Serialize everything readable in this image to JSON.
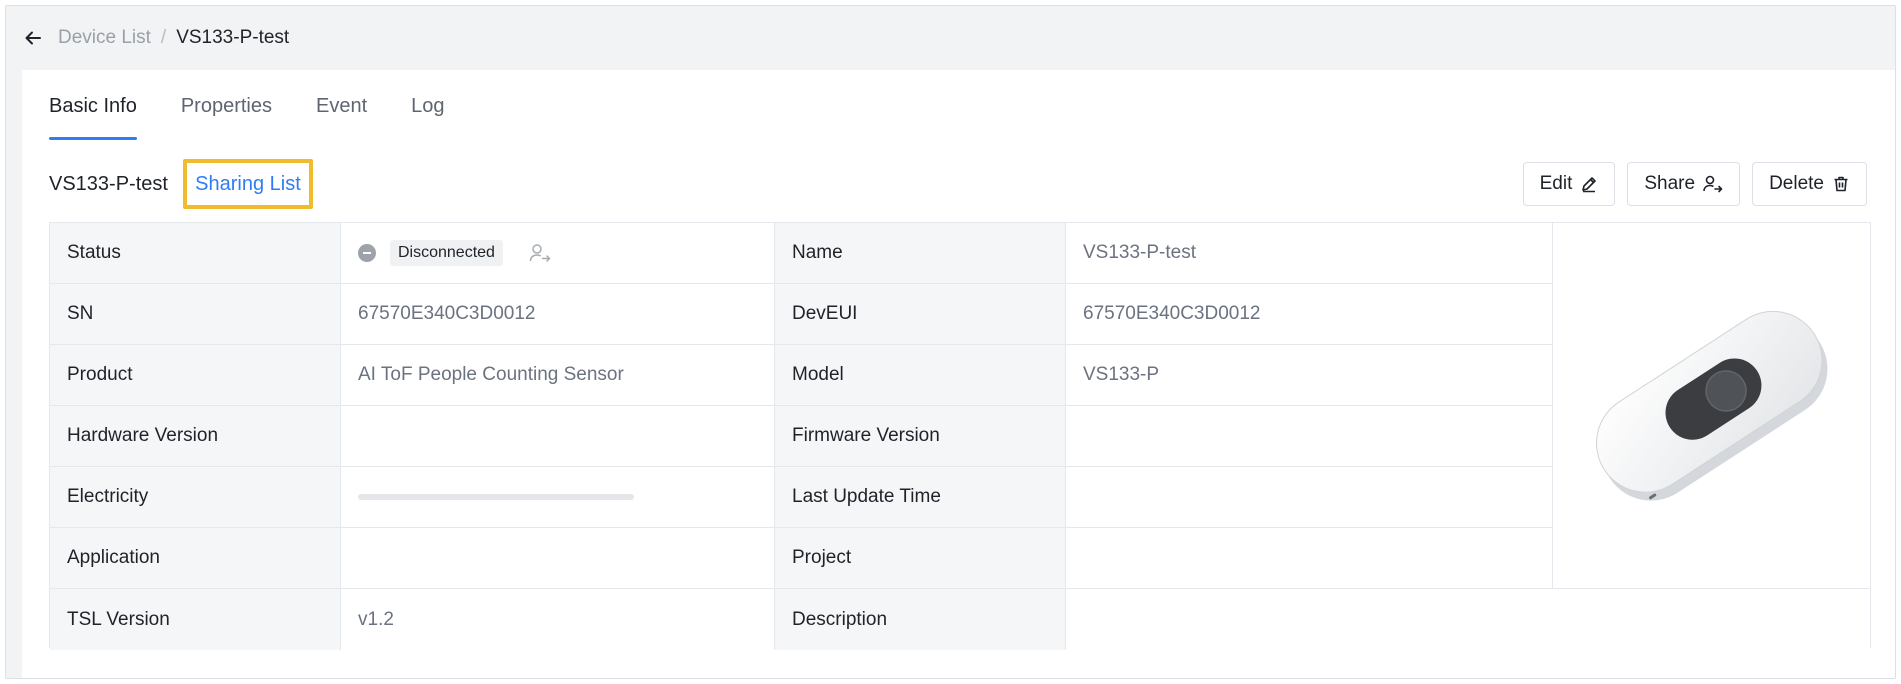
{
  "breadcrumb": {
    "parent": "Device List",
    "separator": "/",
    "current": "VS133-P-test"
  },
  "tabs": [
    {
      "label": "Basic Info",
      "active": true
    },
    {
      "label": "Properties",
      "active": false
    },
    {
      "label": "Event",
      "active": false
    },
    {
      "label": "Log",
      "active": false
    }
  ],
  "device": {
    "name": "VS133-P-test",
    "sharing_link": "Sharing List"
  },
  "actions": {
    "edit": "Edit",
    "share": "Share",
    "delete": "Delete"
  },
  "info": {
    "status_label": "Status",
    "status_value": "Disconnected",
    "name_label": "Name",
    "name_value": "VS133-P-test",
    "sn_label": "SN",
    "sn_value": "67570E340C3D0012",
    "deveui_label": "DevEUI",
    "deveui_value": "67570E340C3D0012",
    "product_label": "Product",
    "product_value": "AI ToF People Counting Sensor",
    "model_label": "Model",
    "model_value": "VS133-P",
    "hardware_label": "Hardware Version",
    "hardware_value": "",
    "firmware_label": "Firmware Version",
    "firmware_value": "",
    "electricity_label": "Electricity",
    "electricity_level": 0,
    "last_update_label": "Last Update Time",
    "last_update_value": "",
    "application_label": "Application",
    "application_value": "",
    "project_label": "Project",
    "project_value": "",
    "tsl_label": "TSL Version",
    "tsl_value": "v1.2",
    "description_label": "Description",
    "description_value": ""
  },
  "icons": {
    "back": "arrow-left-icon",
    "edit": "pencil-icon",
    "share": "user-share-icon",
    "delete": "trash-icon",
    "status": "minus-circle-icon",
    "assign": "user-share-icon"
  },
  "colors": {
    "accent": "#2f7df6",
    "highlight_border": "#f0bb2c",
    "status_grey": "#9ea3ab"
  }
}
